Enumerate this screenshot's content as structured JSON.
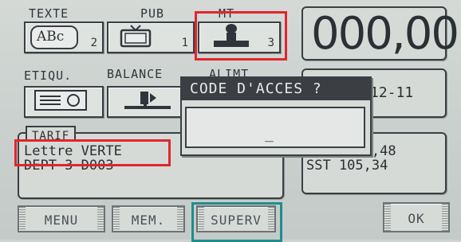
{
  "top_labels": {
    "texte": "TEXTE",
    "pub": "PUB",
    "mt": "MT"
  },
  "counts": {
    "texte": "2",
    "pub": "1",
    "mt": "3"
  },
  "abc_glyph": "ABc",
  "display": {
    "amount": "000,00"
  },
  "row2_labels": {
    "etiqu": "ETIQU.",
    "balance": "BALANCE",
    "alimt": "ALIMT"
  },
  "date_fragment": "12-11",
  "dialog": {
    "title": "CODE D'ACCES ?",
    "cursor": "_"
  },
  "tarif": {
    "heading": "TARIF",
    "line1": "Lettre VERTE",
    "line2": "DEPT 3 D003"
  },
  "totals": {
    "tot": "TOT 1282,48",
    "sst": "SST 105,34"
  },
  "bottom": {
    "menu": "MENU",
    "mem": "MEM.",
    "superv": "SUPERV",
    "ok": "OK"
  },
  "colors": {
    "highlight_red": "#e0262d",
    "highlight_teal": "#1f8d8e",
    "lcd_bg": "#cfd4d1"
  },
  "icons": [
    "abc-text-icon",
    "tv-icon",
    "stamp-icon",
    "label-icon",
    "scale-icon"
  ]
}
